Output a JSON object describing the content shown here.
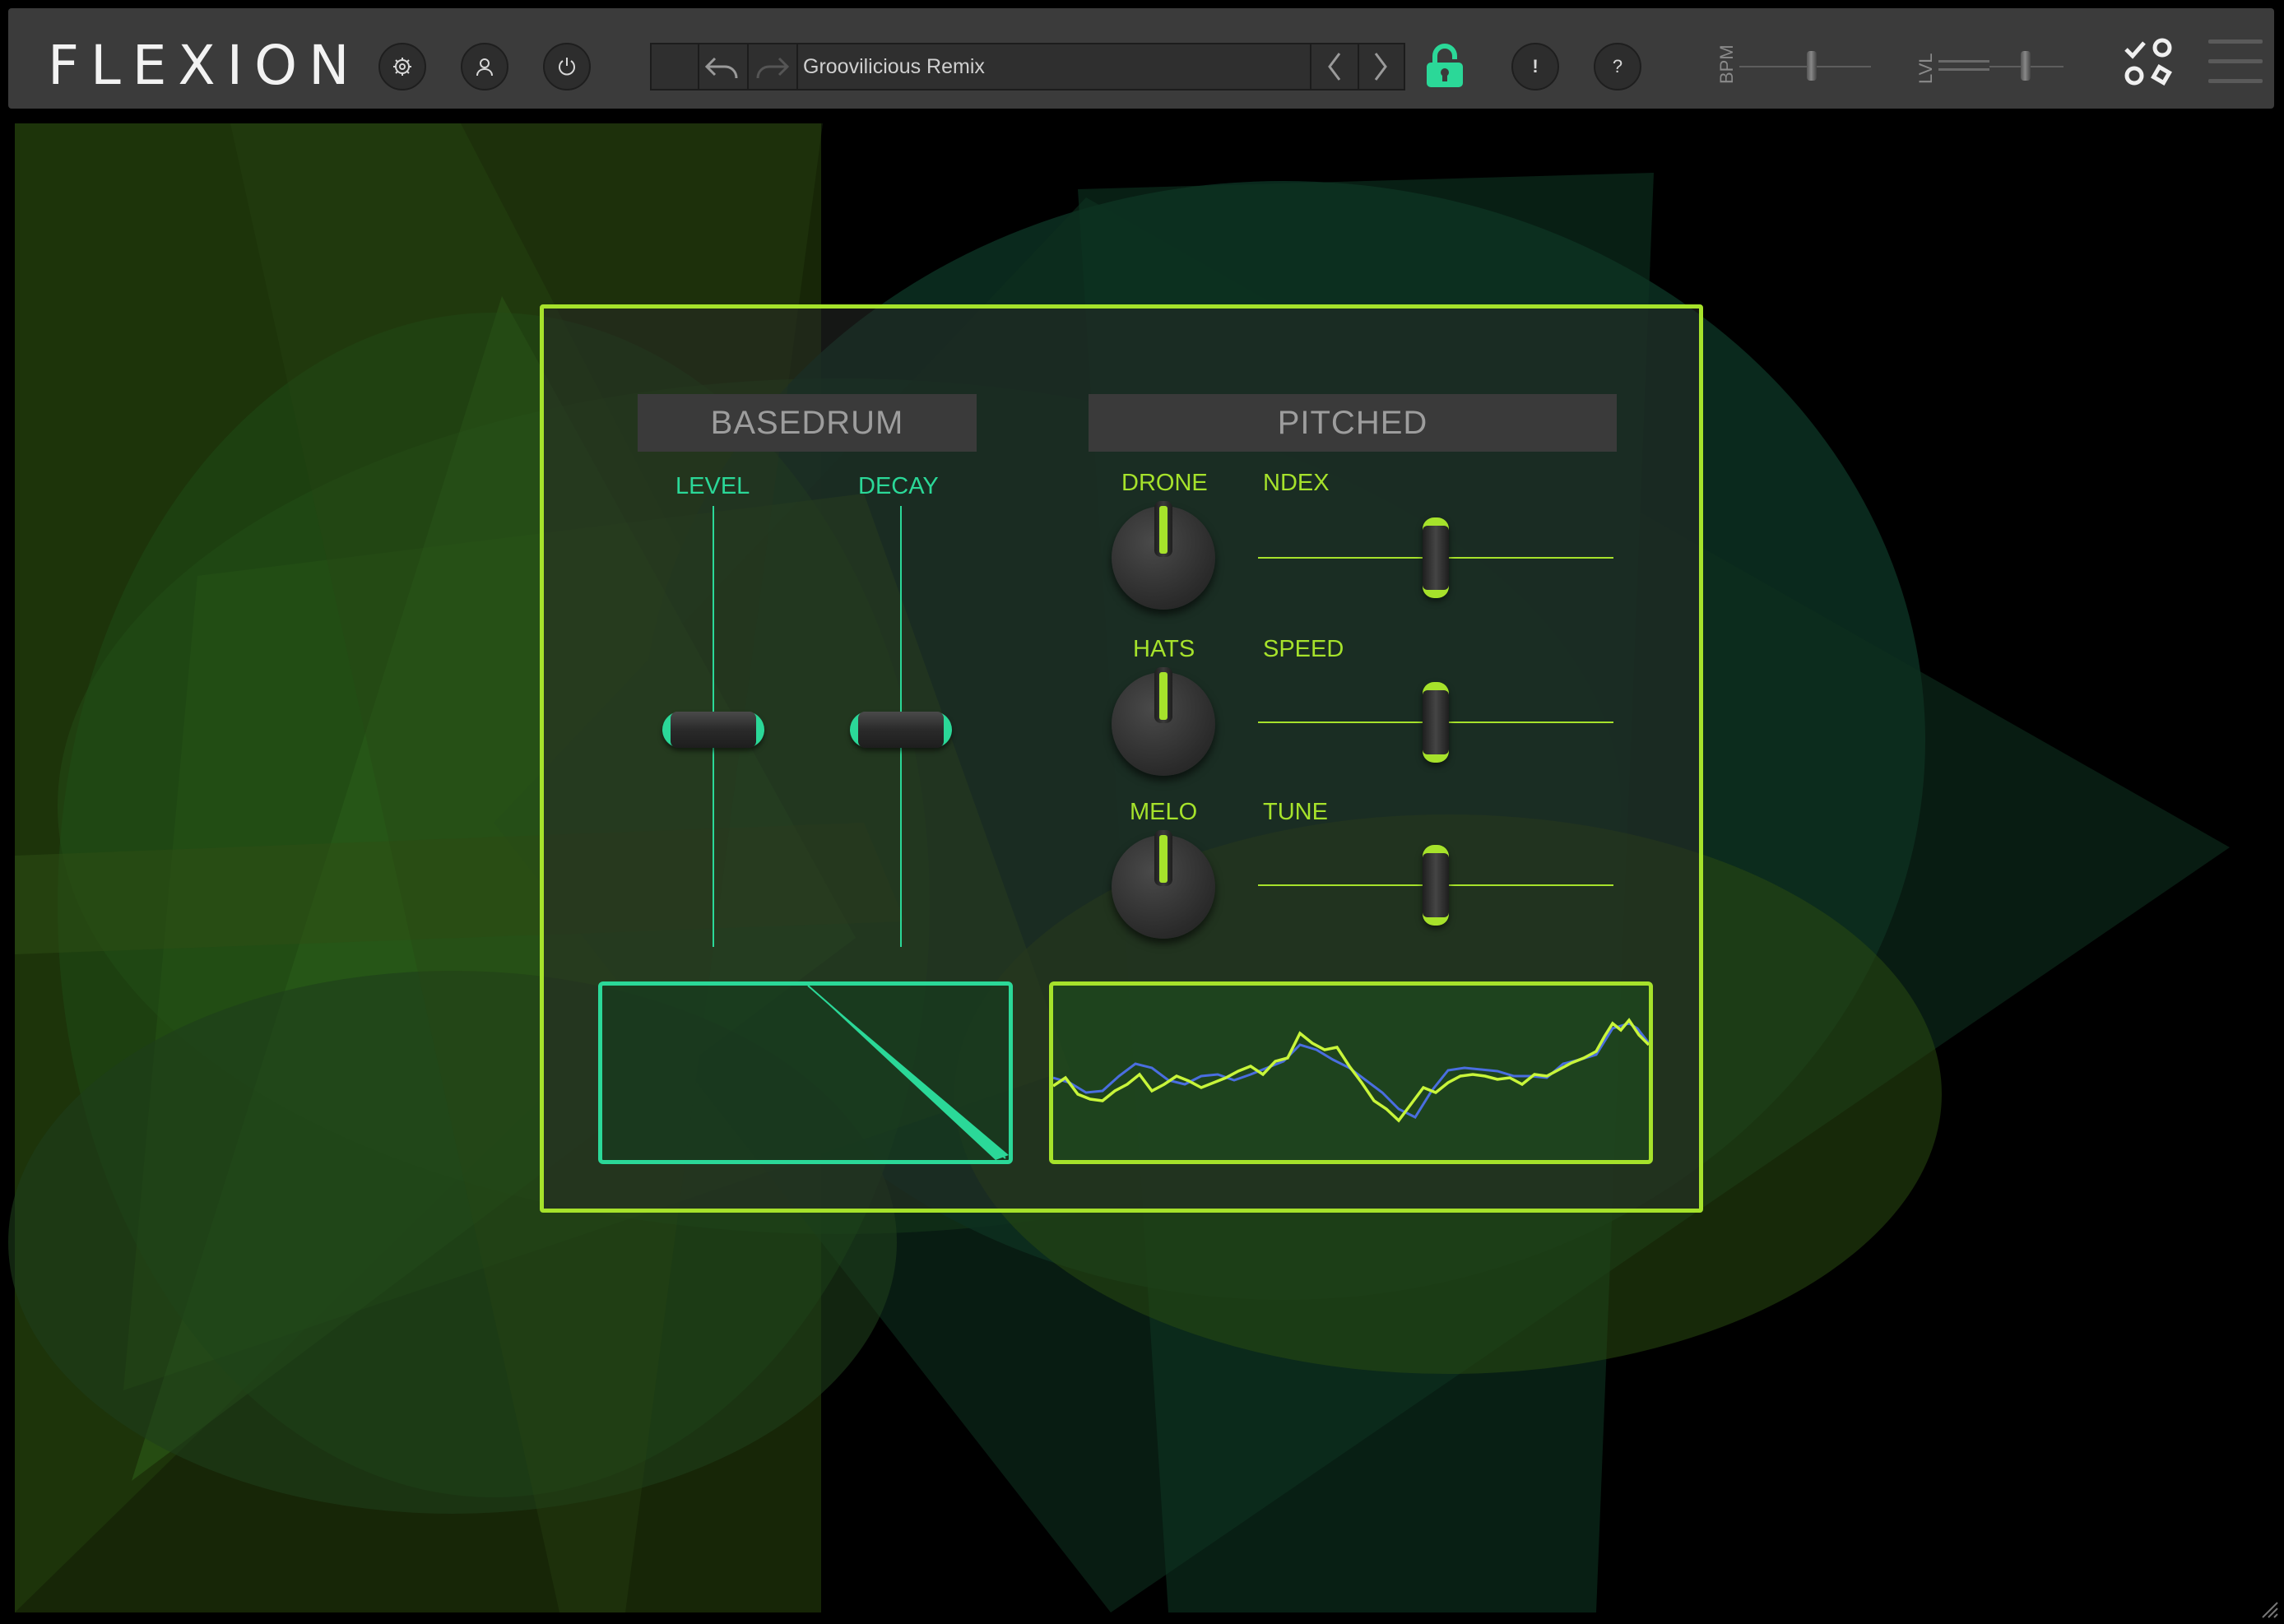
{
  "app": {
    "logo": "FLEXION"
  },
  "toolbar": {
    "settings_icon": "gear-icon",
    "account_icon": "user-icon",
    "power_icon": "power-icon",
    "preset_name": "Groovilicious Remix",
    "undo_icon": "undo-icon",
    "redo_icon": "redo-icon",
    "prev_icon": "chevron-left-icon",
    "next_icon": "chevron-right-icon",
    "lock_icon": "lock-open-icon",
    "info_label": "!",
    "help_label": "?",
    "bpm_label": "BPM",
    "lvl_label": "LVL",
    "bpm_value": 0.55,
    "lvl_value": 0.7
  },
  "basedrum": {
    "title": "BASEDRUM",
    "level_label": "LEVEL",
    "decay_label": "DECAY",
    "level_value": 0.5,
    "decay_value": 0.5
  },
  "pitched": {
    "title": "PITCHED",
    "knobs": [
      {
        "label": "DRONE",
        "value": 0.5
      },
      {
        "label": "HATS",
        "value": 0.5
      },
      {
        "label": "MELO",
        "value": 0.5
      }
    ],
    "sliders": [
      {
        "label": "NDEX",
        "value": 0.5
      },
      {
        "label": "SPEED",
        "value": 0.5
      },
      {
        "label": "TUNE",
        "value": 0.5
      }
    ]
  },
  "colors": {
    "accent_lime": "#a6e22b",
    "accent_teal": "#2bd898",
    "waveform_blue": "#4a6ee0",
    "toolbar_bg": "#3b3b3b"
  }
}
